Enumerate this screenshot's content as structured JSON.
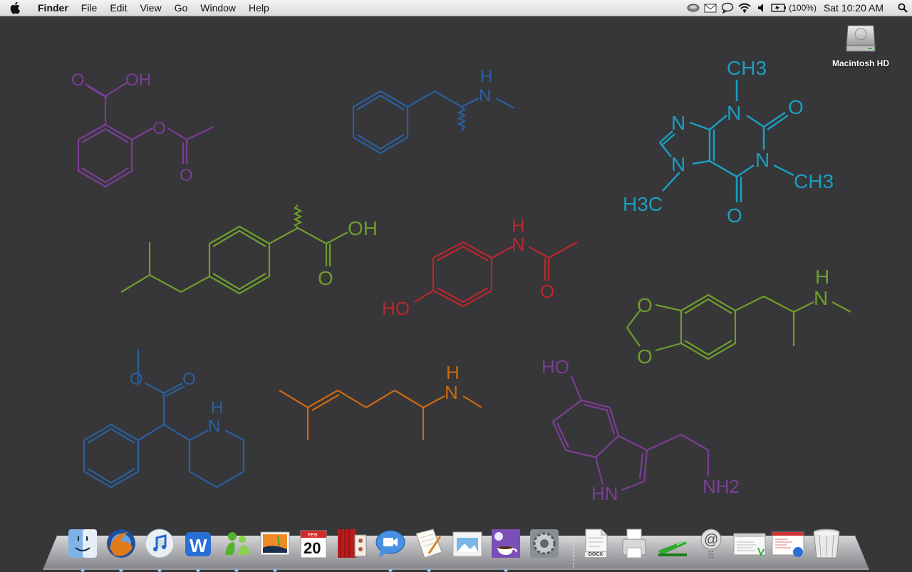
{
  "menubar": {
    "app_name": "Finder",
    "items": [
      "File",
      "Edit",
      "View",
      "Go",
      "Window",
      "Help"
    ],
    "battery": "(100%)",
    "clock": "Sat 10:20 AM",
    "status_icons": [
      "time-machine-icon",
      "mail-icon",
      "chat-icon",
      "wifi-icon",
      "volume-icon",
      "battery-icon",
      "spotlight-icon"
    ]
  },
  "desktop": {
    "disk_label": "Macintosh HD",
    "colors": {
      "background": "#373639",
      "purple": "#7a3f94",
      "blue": "#2c5f9e",
      "cyan": "#1b9fbf",
      "green": "#6e9e2c",
      "red": "#b8282e",
      "orange": "#c86a12"
    },
    "molecule_labels": {
      "aspirin": {
        "o1": "O",
        "oh": "OH",
        "o2": "O",
        "o3": "O"
      },
      "methamphetamine": {
        "h": "H",
        "n": "N"
      },
      "caffeine": {
        "ch3_top": "CH3",
        "n1": "N",
        "n2": "N",
        "n3": "N",
        "n4": "N",
        "o1": "O",
        "o2": "O",
        "ch3_right": "CH3",
        "h3c": "H3C"
      },
      "ibuprofen": {
        "oh": "OH",
        "o": "O"
      },
      "paracetamol": {
        "h": "H",
        "n": "N",
        "o": "O",
        "ho": "HO"
      },
      "mdma": {
        "o1": "O",
        "o2": "O",
        "h": "H",
        "n": "N"
      },
      "methylphenidate": {
        "o1": "O",
        "o2": "O",
        "h": "H",
        "n": "N"
      },
      "isometheptene": {
        "h": "H",
        "n": "N"
      },
      "serotonin": {
        "ho": "HO",
        "hn": "HN",
        "nh2": "NH2"
      }
    }
  },
  "dock": {
    "apps": [
      {
        "name": "Finder",
        "icon": "finder-icon"
      },
      {
        "name": "Firefox",
        "icon": "firefox-icon"
      },
      {
        "name": "iTunes",
        "icon": "itunes-icon"
      },
      {
        "name": "Word",
        "icon": "word-icon"
      },
      {
        "name": "Messenger",
        "icon": "messenger-icon"
      },
      {
        "name": "iPhoto",
        "icon": "iphoto-icon"
      },
      {
        "name": "iCal",
        "icon": "ical-icon"
      },
      {
        "name": "Front Row",
        "icon": "front-row-icon"
      },
      {
        "name": "iChat",
        "icon": "ichat-icon"
      },
      {
        "name": "Pages",
        "icon": "pages-icon"
      },
      {
        "name": "Preview",
        "icon": "preview-icon"
      },
      {
        "name": "Java",
        "icon": "java-icon"
      },
      {
        "name": "System Preferences",
        "icon": "system-preferences-icon"
      }
    ],
    "ical_month": "FEB",
    "ical_day": "20",
    "docx_label": "DOCX",
    "docs": [
      {
        "name": "Document",
        "icon": "docx-icon"
      },
      {
        "name": "Printer",
        "icon": "printer-icon"
      },
      {
        "name": "Stapler",
        "icon": "stapler-icon"
      },
      {
        "name": "Mail stack",
        "icon": "mail-stack-icon"
      },
      {
        "name": "Activity Monitor",
        "icon": "activity-monitor-icon"
      },
      {
        "name": "Browser",
        "icon": "browser-window-icon"
      },
      {
        "name": "Trash",
        "icon": "trash-icon"
      }
    ]
  }
}
